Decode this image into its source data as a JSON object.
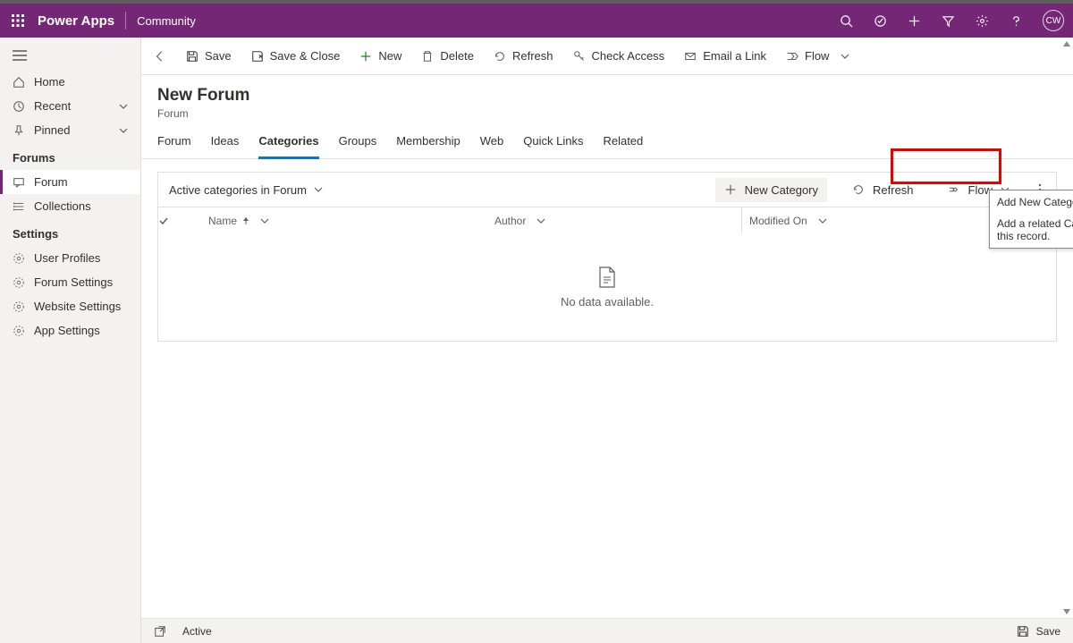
{
  "topbar": {
    "app_title": "Power Apps",
    "app_sub": "Community",
    "avatar_initials": "CW"
  },
  "sidebar": {
    "home": "Home",
    "recent": "Recent",
    "pinned": "Pinned",
    "header_forums": "Forums",
    "forum": "Forum",
    "collections": "Collections",
    "header_settings": "Settings",
    "user_profiles": "User Profiles",
    "forum_settings": "Forum Settings",
    "website_settings": "Website Settings",
    "app_settings": "App Settings"
  },
  "cmdbar": {
    "save": "Save",
    "save_close": "Save & Close",
    "new": "New",
    "delete": "Delete",
    "refresh": "Refresh",
    "check_access": "Check Access",
    "email_link": "Email a Link",
    "flow": "Flow"
  },
  "page": {
    "title": "New Forum",
    "subtitle": "Forum"
  },
  "tabs": [
    "Forum",
    "Ideas",
    "Categories",
    "Groups",
    "Membership",
    "Web",
    "Quick Links",
    "Related"
  ],
  "active_tab_index": 2,
  "subgrid": {
    "view_name": "Active categories in Forum",
    "new_category": "New Category",
    "refresh": "Refresh",
    "flow": "Flow",
    "col_name": "Name",
    "col_author": "Author",
    "col_modified": "Modified On",
    "no_data": "No data available."
  },
  "tooltip": {
    "title": "Add New Category",
    "body": "Add a related Category to this record."
  },
  "statusbar": {
    "status": "Active",
    "save": "Save"
  }
}
